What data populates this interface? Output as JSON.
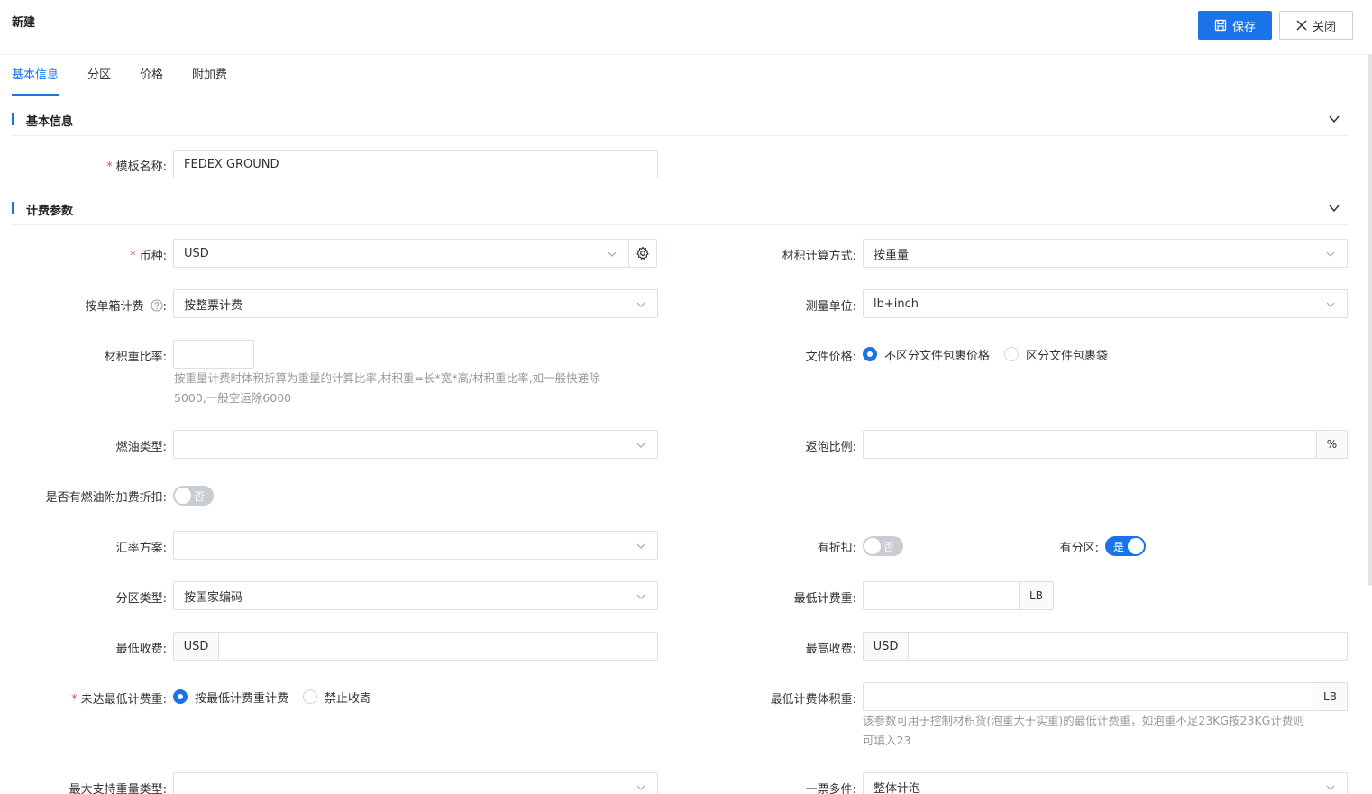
{
  "page": {
    "title": "新建"
  },
  "toolbar": {
    "save_label": "保存",
    "close_label": "关闭"
  },
  "tabs": [
    {
      "label": "基本信息",
      "active": true
    },
    {
      "label": "分区",
      "active": false
    },
    {
      "label": "价格",
      "active": false
    },
    {
      "label": "附加费",
      "active": false
    }
  ],
  "sections": {
    "basic": {
      "title": "基本信息"
    },
    "billing": {
      "title": "计费参数"
    }
  },
  "form": {
    "template_name": {
      "label": "模板名称:",
      "value": "FEDEX GROUND",
      "required": true
    },
    "currency": {
      "label": "币种:",
      "value": "USD",
      "required": true
    },
    "volume_calc": {
      "label": "材积计算方式:",
      "value": "按重量"
    },
    "per_box": {
      "label": "按单箱计费",
      "suffix": ":",
      "value": "按整票计费"
    },
    "unit": {
      "label": "测量单位:",
      "value": "lb+inch"
    },
    "volume_ratio": {
      "label": "材积重比率:",
      "value": "",
      "hint_line1": "按重量计费时体积折算为重量的计算比率,材积重=长*宽*高/材积重比率,如一般快递除",
      "hint_line2": "5000,一般空运除6000"
    },
    "doc_price": {
      "label": "文件价格:",
      "options": [
        "不区分文件包裹价格",
        "区分文件包裹袋"
      ],
      "selected": 0
    },
    "fuel_type": {
      "label": "燃油类型:",
      "value": ""
    },
    "rebate_ratio": {
      "label": "返泡比例:",
      "value": "",
      "unit": "%"
    },
    "fuel_discount": {
      "label": "是否有燃油附加费折扣:",
      "switch_text": "否",
      "on": false
    },
    "exchange_plan": {
      "label": "汇率方案:",
      "value": ""
    },
    "has_discount": {
      "label": "有折扣:",
      "switch_text": "否",
      "on": false
    },
    "has_zone": {
      "label": "有分区:",
      "switch_text": "是",
      "on": true
    },
    "zone_type": {
      "label": "分区类型:",
      "value": "按国家编码"
    },
    "min_weight": {
      "label": "最低计费重:",
      "value": "",
      "unit": "LB"
    },
    "min_charge": {
      "label": "最低收费:",
      "currency": "USD",
      "value": ""
    },
    "max_charge": {
      "label": "最高收费:",
      "currency": "USD",
      "value": ""
    },
    "below_min": {
      "label": "未达最低计费重:",
      "required": true,
      "options": [
        "按最低计费重计费",
        "禁止收寄"
      ],
      "selected": 0
    },
    "min_volume_weight": {
      "label": "最低计费体积重:",
      "value": "",
      "unit": "LB",
      "hint_line1": "该参数可用于控制材积货(泡重大于实重)的最低计费重，如泡重不足23KG按23KG计费则",
      "hint_line2": "可填入23"
    },
    "max_weight_type": {
      "label": "最大支持重量类型:",
      "value": ""
    },
    "multi_piece": {
      "label": "一票多件:",
      "value": "整体计泡"
    }
  }
}
